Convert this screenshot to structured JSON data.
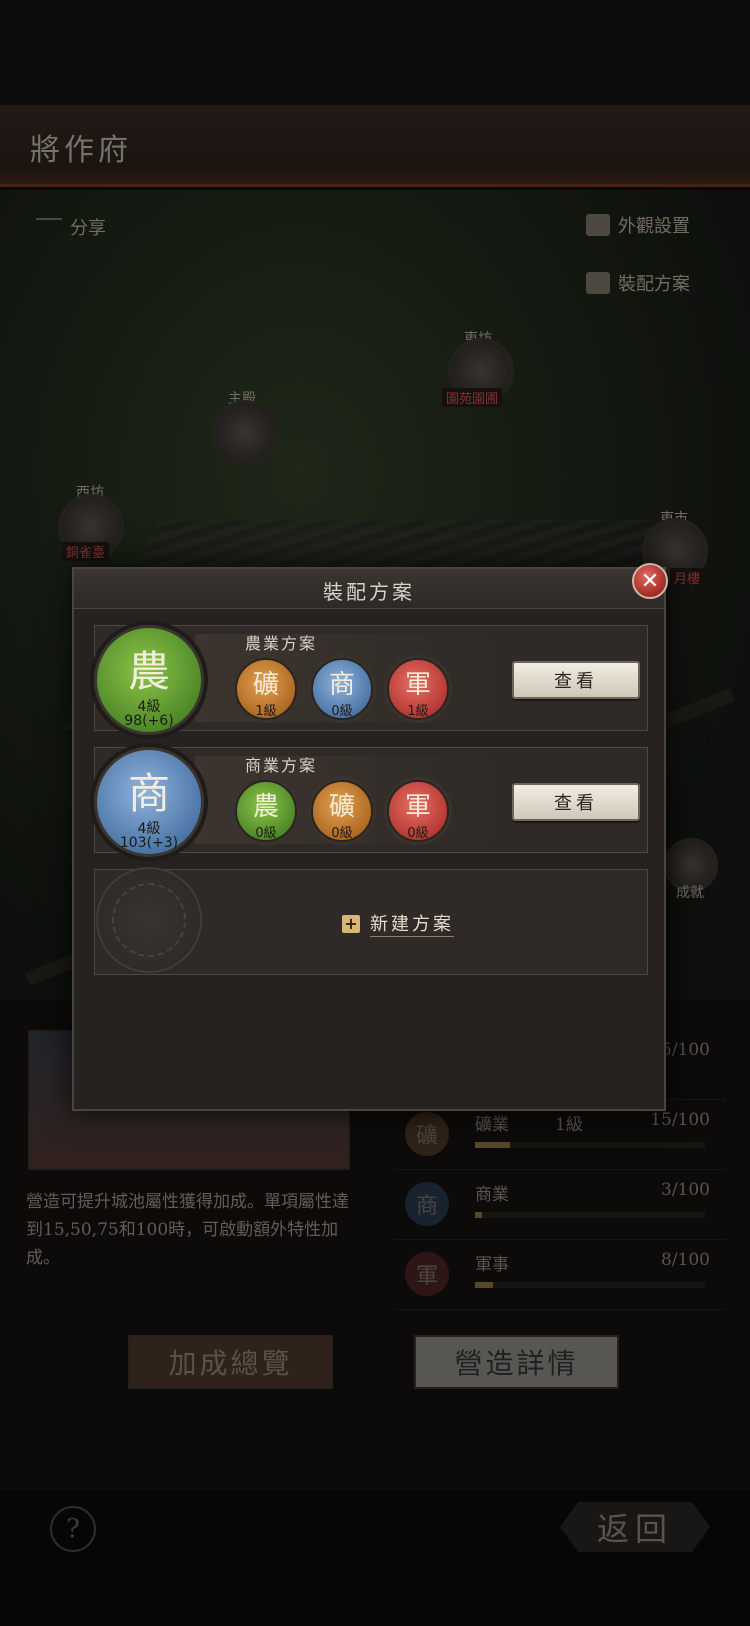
{
  "header": {
    "title": "將作府"
  },
  "map": {
    "share_label": "分享",
    "appearance_label": "外觀設置",
    "loadout_label": "裝配方案",
    "nodes": {
      "east_ward": "東坊",
      "east_ward_tag": "園苑園圃",
      "main_hall": "主殿",
      "west_ward": "西坊",
      "west_ward_tag": "銅雀臺",
      "east_market": "東市",
      "east_market_tag": "月樓",
      "achievement": "成就"
    }
  },
  "info": {
    "description": "營造可提升城池屬性獲得加成。單項屬性達到15,50,75和100時，可啟動額外特性加成。",
    "stats": [
      {
        "glyph": "礦",
        "name": "礦業",
        "level": "1級",
        "value": "15/100",
        "progress": 0.15
      },
      {
        "glyph": "商",
        "name": "商業",
        "level": "",
        "value": "3/100",
        "progress": 0.03
      },
      {
        "glyph": "軍",
        "name": "軍事",
        "level": "",
        "value": "8/100",
        "progress": 0.08
      }
    ],
    "first_stat_value": "5/100",
    "bonus_button": "加成總覽",
    "detail_button": "營造詳情"
  },
  "footer": {
    "help": "?",
    "back": "返回"
  },
  "modal": {
    "title": "裝配方案",
    "close": "✕",
    "plans": [
      {
        "name": "農業方案",
        "glyph": "農",
        "level": "4級",
        "points": "98(+6)",
        "color": "#5a922e",
        "subs": [
          {
            "glyph": "礦",
            "level": "1級",
            "color": "#b06a24"
          },
          {
            "glyph": "商",
            "level": "0級",
            "color": "#4d77a8"
          },
          {
            "glyph": "軍",
            "level": "1級",
            "color": "#b53a34"
          }
        ],
        "view_label": "查看"
      },
      {
        "name": "商業方案",
        "glyph": "商",
        "level": "4級",
        "points": "103(+3)",
        "color": "#4d77a8",
        "subs": [
          {
            "glyph": "農",
            "level": "0級",
            "color": "#5a922e"
          },
          {
            "glyph": "礦",
            "level": "0級",
            "color": "#b06a24"
          },
          {
            "glyph": "軍",
            "level": "0級",
            "color": "#b53a34"
          }
        ],
        "view_label": "查看"
      }
    ],
    "new_plan_label": "新建方案"
  }
}
